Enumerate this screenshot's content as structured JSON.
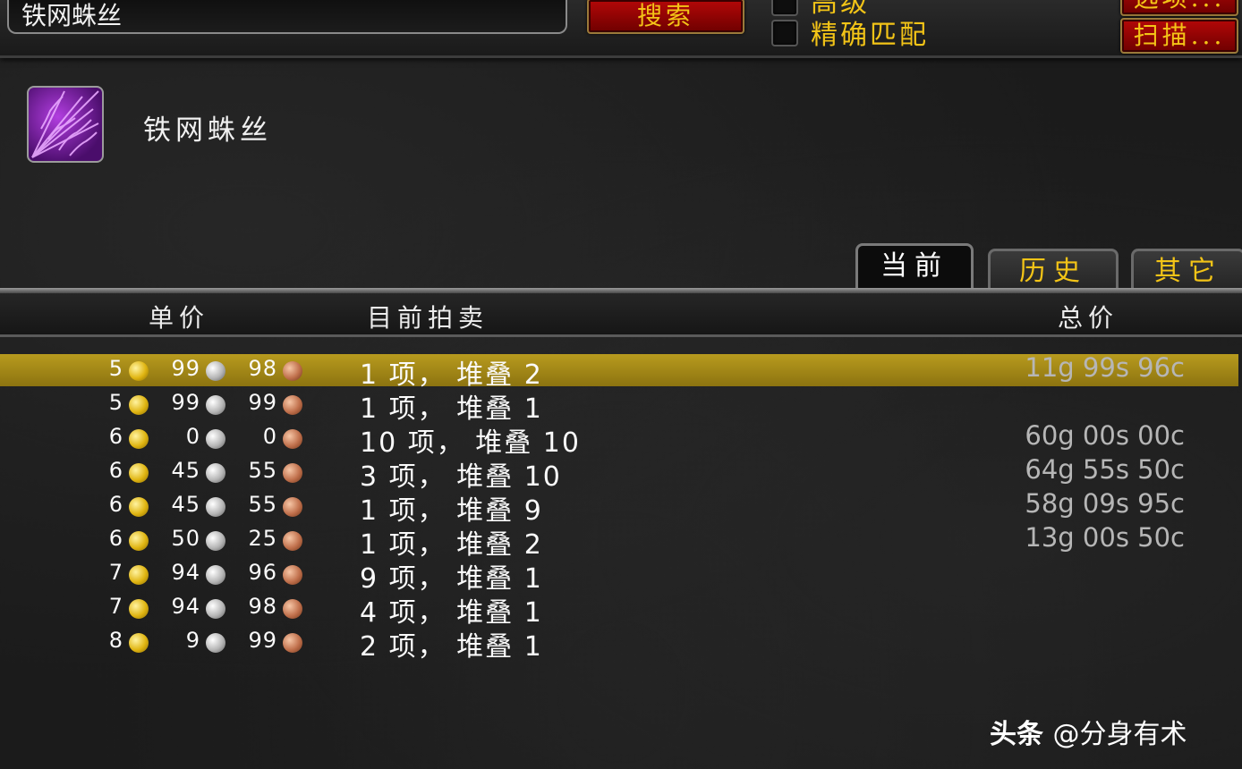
{
  "search": {
    "value": "铁网蛛丝",
    "button_label": "搜索",
    "options_label": "选项...",
    "scan_label": "扫描...",
    "advanced_label": "高级",
    "exact_match_label": "精确匹配"
  },
  "item": {
    "icon": "spider-web-icon",
    "name": "铁网蛛丝"
  },
  "tabs": [
    {
      "label": "当前",
      "active": true
    },
    {
      "label": "历史",
      "active": false
    },
    {
      "label": "其它",
      "active": false
    }
  ],
  "columns": {
    "unit_price": "单价",
    "current_auctions": "目前拍卖",
    "total_price": "总价"
  },
  "rows": [
    {
      "gold": "5",
      "silver": "99",
      "copper": "98",
      "stack": "1 项， 堆叠 2",
      "total": "11g 99s 96c",
      "selected": true
    },
    {
      "gold": "5",
      "silver": "99",
      "copper": "99",
      "stack": "1 项， 堆叠 1",
      "total": "",
      "selected": false
    },
    {
      "gold": "6",
      "silver": "0",
      "copper": "0",
      "stack": "10 项， 堆叠 10",
      "total": "60g 00s 00c",
      "selected": false
    },
    {
      "gold": "6",
      "silver": "45",
      "copper": "55",
      "stack": "3 项， 堆叠 10",
      "total": "64g 55s 50c",
      "selected": false
    },
    {
      "gold": "6",
      "silver": "45",
      "copper": "55",
      "stack": "1 项， 堆叠 9",
      "total": "58g 09s 95c",
      "selected": false
    },
    {
      "gold": "6",
      "silver": "50",
      "copper": "25",
      "stack": "1 项， 堆叠 2",
      "total": "13g 00s 50c",
      "selected": false
    },
    {
      "gold": "7",
      "silver": "94",
      "copper": "96",
      "stack": "9 项， 堆叠 1",
      "total": "",
      "selected": false
    },
    {
      "gold": "7",
      "silver": "94",
      "copper": "98",
      "stack": "4 项， 堆叠 1",
      "total": "",
      "selected": false
    },
    {
      "gold": "8",
      "silver": "9",
      "copper": "99",
      "stack": "2 项， 堆叠 1",
      "total": "",
      "selected": false
    }
  ],
  "watermark": {
    "brand": "头条",
    "user": "@分身有术"
  },
  "colors": {
    "accent_gold": "#f3c417",
    "button_red": "#b40808",
    "selected_row": "#b89b1e"
  }
}
